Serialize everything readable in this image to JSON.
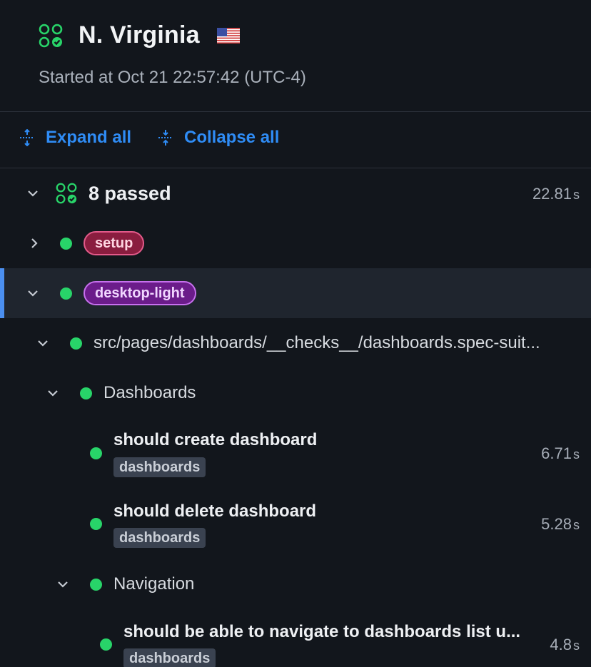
{
  "header": {
    "region": "N. Virginia",
    "flag": "us-flag-icon",
    "started": "Started at Oct 21 22:57:42 (UTC-4)"
  },
  "toolbar": {
    "expand_label": "Expand all",
    "collapse_label": "Collapse all"
  },
  "summary": {
    "label": "8 passed",
    "duration": "22.81",
    "unit": "s"
  },
  "tree": {
    "setup": {
      "tag": "setup"
    },
    "desktop": {
      "tag": "desktop-light"
    },
    "file": {
      "label": "src/pages/dashboards/__checks__/dashboards.spec-suit..."
    },
    "suite_dashboards": {
      "label": "Dashboards"
    },
    "test1": {
      "title": "should create dashboard",
      "tag": "dashboards",
      "duration": "6.71",
      "unit": "s"
    },
    "test2": {
      "title": "should delete dashboard",
      "tag": "dashboards",
      "duration": "5.28",
      "unit": "s"
    },
    "suite_navigation": {
      "label": "Navigation"
    },
    "test3": {
      "title": "should be able to navigate to dashboards list u...",
      "tag": "dashboards",
      "duration": "4.8",
      "unit": "s"
    }
  },
  "colors": {
    "pass": "#28d469",
    "accent": "#2f8cf5",
    "background": "#12161c"
  }
}
